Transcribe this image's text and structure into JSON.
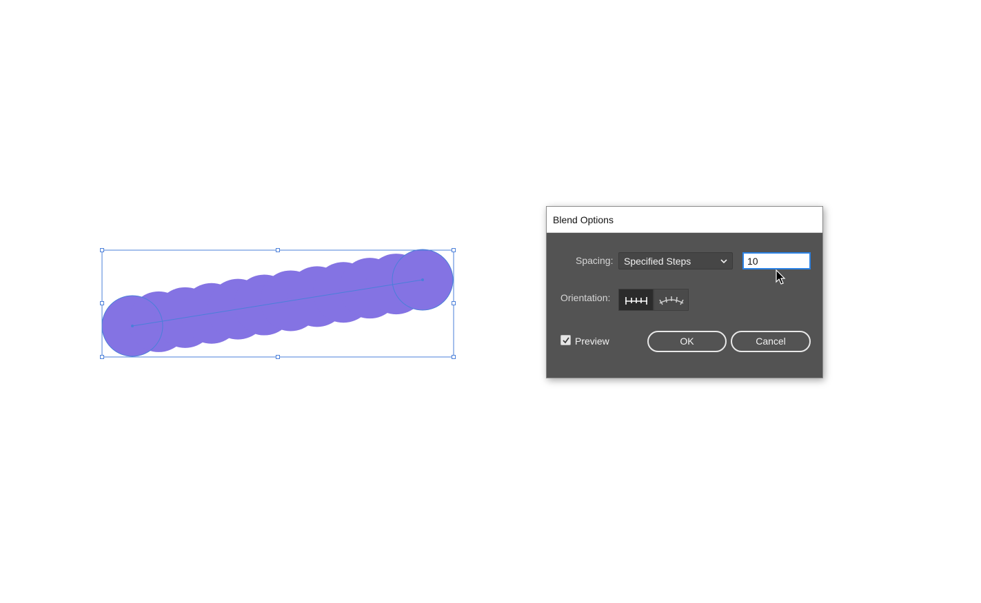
{
  "canvas": {
    "blend_color": "#8473e3",
    "selection_color": "#4a7fd9"
  },
  "dialog": {
    "title": "Blend Options",
    "spacing_label": "Spacing:",
    "spacing_value": "Specified Steps",
    "steps_value": "10",
    "orientation_label": "Orientation:",
    "orientation_options": [
      "align-to-page-icon",
      "align-to-path-icon"
    ],
    "orientation_selected": "align-to-page-icon",
    "preview_label": "Preview",
    "preview_checked": true,
    "ok_label": "OK",
    "cancel_label": "Cancel"
  }
}
